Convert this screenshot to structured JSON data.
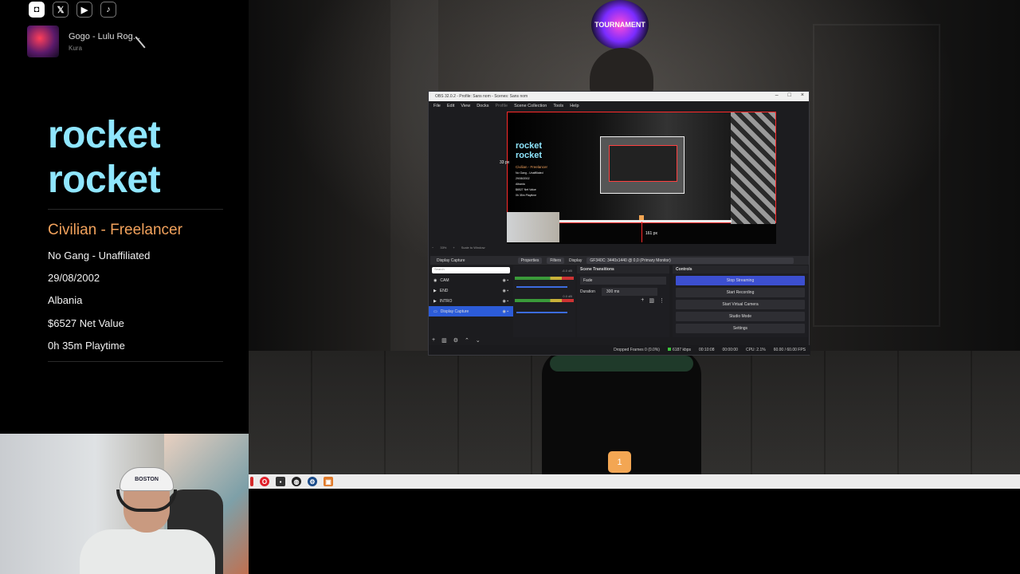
{
  "socials": [
    {
      "icon": "instagram-icon",
      "glyph": "◘"
    },
    {
      "icon": "x-twitter-icon",
      "glyph": "𝕏"
    },
    {
      "icon": "youtube-icon",
      "glyph": "▶"
    },
    {
      "icon": "tiktok-icon",
      "glyph": "♪"
    }
  ],
  "now_playing": {
    "title": "Gogo - Lulu Rog...",
    "artist": "Kura"
  },
  "profile": {
    "name_line1": "rocket",
    "name_line2": "rocket",
    "occupation": "Civilian - Freelancer",
    "gang": "No Gang - Unaffiliated",
    "dob": "29/08/2002",
    "country": "Albania",
    "net_value": "$6527 Net Value",
    "playtime": "0h 35m Playtime"
  },
  "webcam": {
    "cap_text": "BOSTON"
  },
  "game": {
    "logo_text": "TOURNAMENT"
  },
  "page_badge": "1",
  "obs": {
    "title": "OBS 32.0.2 - Profile: Sans nom - Scenes: Sans nom",
    "window_controls": [
      "–",
      "□",
      "×"
    ],
    "menu": [
      "File",
      "Edit",
      "View",
      "Docks",
      "Profile",
      "Scene Collection",
      "Tools",
      "Help"
    ],
    "preview": {
      "name_line1": "rocket",
      "name_line2": "rocket",
      "occupation": "Civilian - Freelancer",
      "info": [
        "No Gang - Unaffiliated",
        "29/08/2002",
        "Albania",
        "$6527 Net Value",
        "0h 35m Playtime"
      ],
      "px_bottom": "161 px",
      "px_left": "33 px"
    },
    "zoom": {
      "level": "33%",
      "scale_label": "Scale to Window"
    },
    "source_bar": {
      "source": "Display Capture",
      "properties": "Properties",
      "filters": "Filters",
      "display_label": "Display",
      "display_value": "GF340C: 3440x1440 @ 0,0 (Primary Monitor)"
    },
    "scene_search_placeholder": "Search",
    "scenes": [
      {
        "label": "CAM",
        "icon": "camera-icon"
      },
      {
        "label": "END",
        "icon": "play-icon"
      },
      {
        "label": "INTRO",
        "icon": "play-icon"
      },
      {
        "label": "Display Capture",
        "icon": "monitor-icon"
      }
    ],
    "mixer": {
      "db1": "-6.0 dB",
      "db2": "0.0 dB"
    },
    "transitions": {
      "title": "Scene Transitions",
      "type": "Fade",
      "duration_label": "Duration",
      "duration_value": "300 ms"
    },
    "controls": {
      "title": "Controls",
      "buttons": [
        "Stop Streaming",
        "Start Recording",
        "Start Virtual Camera",
        "Studio Mode",
        "Settings"
      ]
    },
    "status": {
      "dropped": "Dropped Frames 0 (0.0%)",
      "kbps": "6187 kbps",
      "stream_time": "00:10:08",
      "rec_time": "00:00:00",
      "cpu": "CPU: 2.1%",
      "fps": "60.00 / 60.00 FPS"
    }
  },
  "taskbar": [
    {
      "icon": "red-app-icon",
      "color": "#d42a2a"
    },
    {
      "icon": "opera-icon",
      "color": "#e0202a"
    },
    {
      "icon": "terminal-icon",
      "color": "#333333"
    },
    {
      "icon": "obs-icon",
      "color": "#222222"
    },
    {
      "icon": "steam-icon",
      "color": "#1b4c8a"
    },
    {
      "icon": "orange-app-icon",
      "color": "#e07a2a"
    }
  ]
}
